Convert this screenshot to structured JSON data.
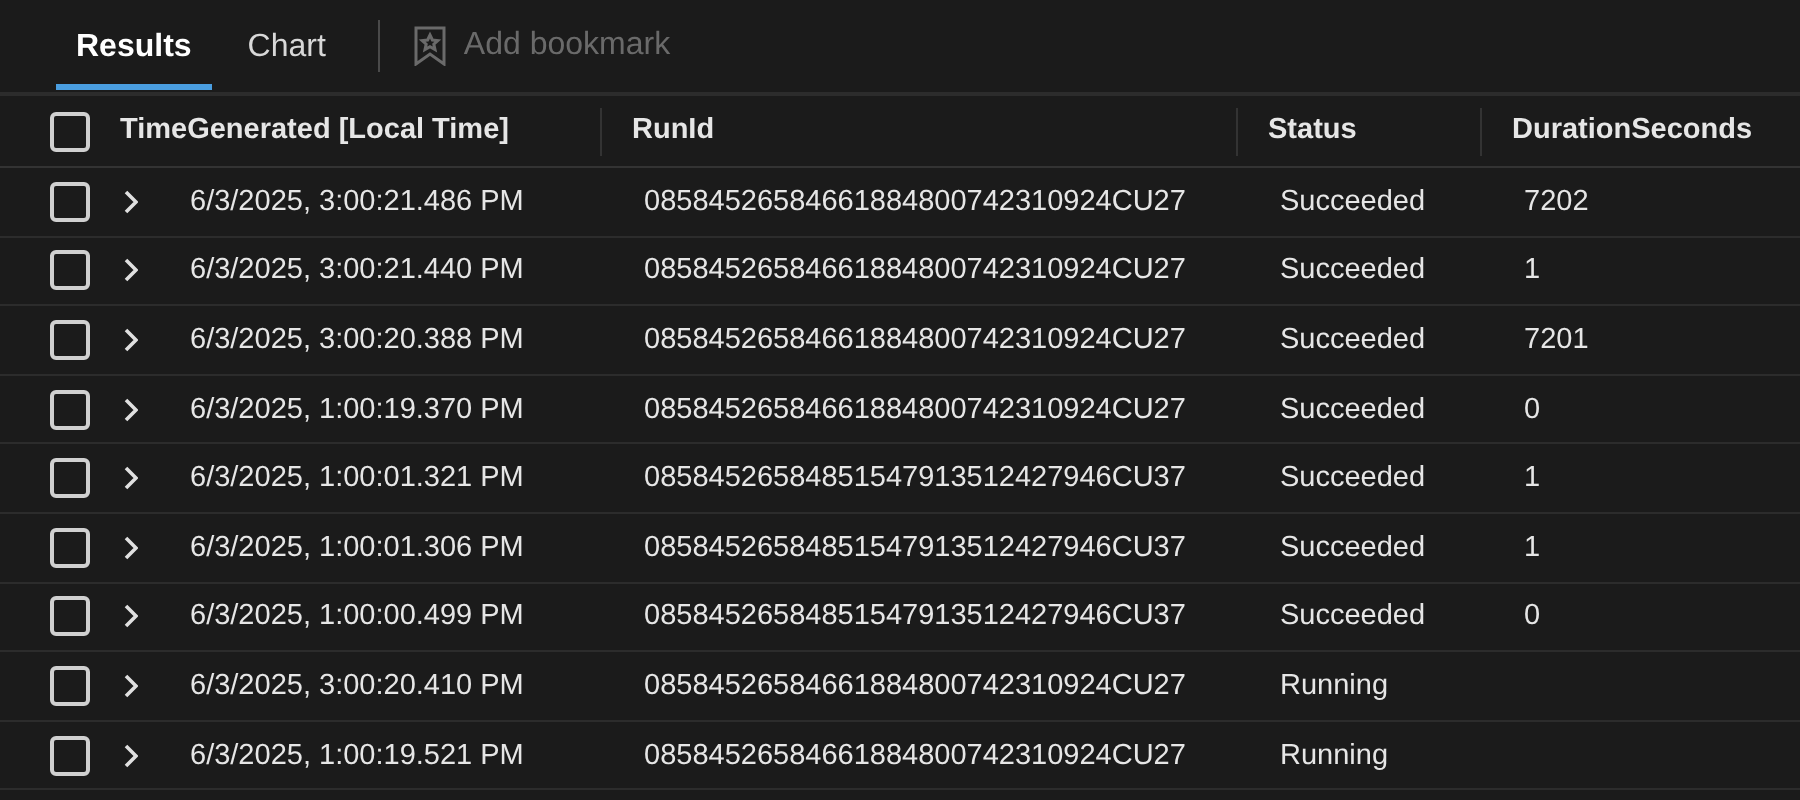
{
  "tabs": [
    {
      "label": "Results",
      "selected": true
    },
    {
      "label": "Chart",
      "selected": false
    }
  ],
  "bookmark_button": {
    "label": "Add bookmark",
    "disabled": true
  },
  "table": {
    "columns": [
      "TimeGenerated [Local Time]",
      "RunId",
      "Status",
      "DurationSeconds"
    ],
    "header_checked": false,
    "rows": [
      {
        "checked": false,
        "expanded": false,
        "cells": [
          "6/3/2025, 3:00:21.486 PM",
          "08584526584661884800742310924CU27",
          "Succeeded",
          "7202"
        ]
      },
      {
        "checked": false,
        "expanded": false,
        "cells": [
          "6/3/2025, 3:00:21.440 PM",
          "08584526584661884800742310924CU27",
          "Succeeded",
          "1"
        ]
      },
      {
        "checked": false,
        "expanded": false,
        "cells": [
          "6/3/2025, 3:00:20.388 PM",
          "08584526584661884800742310924CU27",
          "Succeeded",
          "7201"
        ]
      },
      {
        "checked": false,
        "expanded": false,
        "cells": [
          "6/3/2025, 1:00:19.370 PM",
          "08584526584661884800742310924CU27",
          "Succeeded",
          "0"
        ]
      },
      {
        "checked": false,
        "expanded": false,
        "cells": [
          "6/3/2025, 1:00:01.321 PM",
          "08584526584851547913512427946CU37",
          "Succeeded",
          "1"
        ]
      },
      {
        "checked": false,
        "expanded": false,
        "cells": [
          "6/3/2025, 1:00:01.306 PM",
          "08584526584851547913512427946CU37",
          "Succeeded",
          "1"
        ]
      },
      {
        "checked": false,
        "expanded": false,
        "cells": [
          "6/3/2025, 1:00:00.499 PM",
          "08584526584851547913512427946CU37",
          "Succeeded",
          "0"
        ]
      },
      {
        "checked": false,
        "expanded": false,
        "cells": [
          "6/3/2025, 3:00:20.410 PM",
          "08584526584661884800742310924CU27",
          "Running"
        ]
      },
      {
        "checked": false,
        "expanded": false,
        "cells": [
          "6/3/2025, 1:00:19.521 PM",
          "08584526584661884800742310924CU27",
          "Running"
        ]
      }
    ]
  }
}
